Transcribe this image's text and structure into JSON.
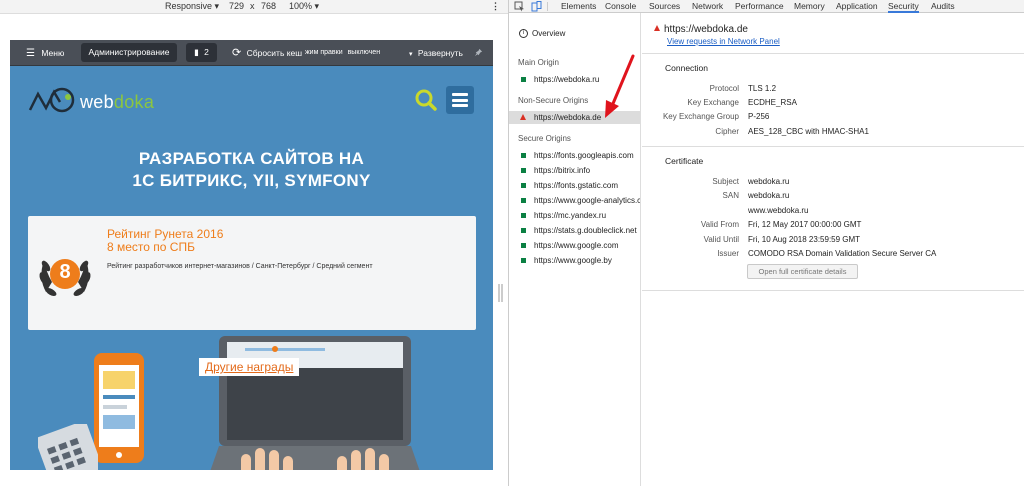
{
  "emulation": {
    "device": "Responsive",
    "width": "729",
    "times": "x",
    "height": "768",
    "zoom": "100%"
  },
  "panel": {
    "menu": "Меню",
    "admin": "Администрирование",
    "counter": "2",
    "reset_cache": "Сбросить кеш",
    "edit_mode": "жим правки",
    "edit_state": "выключен",
    "expand": "Развернуть"
  },
  "site": {
    "logo_web": "web",
    "logo_doka": "doka",
    "headline_1": "РАЗРАБОТКА САЙТОВ НА",
    "headline_2": "1С БИТРИКС, YII, SYMFONY",
    "award_title_1": "Рейтинг Рунета 2016",
    "award_title_2": "8 место по СПБ",
    "award_desc": "Рейтинг разработчиков интернет-магазинов / Санкт-Петербург / Средний сегмент",
    "medal_number": "8",
    "more_awards": "Другие награды"
  },
  "devtools": {
    "tabs": [
      "Elements",
      "Console",
      "Sources",
      "Network",
      "Performance",
      "Memory",
      "Application",
      "Security",
      "Audits"
    ],
    "active_tab": "Security",
    "sidebar": {
      "overview": "Overview",
      "main_origin_header": "Main Origin",
      "main_origin": "https://webdoka.ru",
      "non_secure_header": "Non-Secure Origins",
      "non_secure_origin": "https://webdoka.de",
      "secure_header": "Secure Origins",
      "secure_origins": [
        "https://fonts.googleapis.com",
        "https://bitrix.info",
        "https://fonts.gstatic.com",
        "https://www.google-analytics.com",
        "https://mc.yandex.ru",
        "https://stats.g.doubleclick.net",
        "https://www.google.com",
        "https://www.google.by"
      ]
    },
    "main": {
      "origin": "https://webdoka.de",
      "network_link": "View requests in Network Panel",
      "connection_title": "Connection",
      "connection": [
        {
          "label": "Protocol",
          "value": "TLS 1.2"
        },
        {
          "label": "Key Exchange",
          "value": "ECDHE_RSA"
        },
        {
          "label": "Key Exchange Group",
          "value": "P-256"
        },
        {
          "label": "Cipher",
          "value": "AES_128_CBC with HMAC-SHA1"
        }
      ],
      "certificate_title": "Certificate",
      "certificate": [
        {
          "label": "Subject",
          "value": "webdoka.ru"
        },
        {
          "label": "SAN",
          "value": "webdoka.ru"
        },
        {
          "label": "",
          "value": "www.webdoka.ru"
        },
        {
          "label": "Valid From",
          "value": "Fri, 12 May 2017 00:00:00 GMT"
        },
        {
          "label": "Valid Until",
          "value": "Fri, 10 Aug 2018 23:59:59 GMT"
        },
        {
          "label": "Issuer",
          "value": "COMODO RSA Domain Validation Secure Server CA"
        }
      ],
      "cert_button": "Open full certificate details"
    }
  },
  "colors": {
    "accent": "#3879d9",
    "site_blue": "#4a8bbd",
    "award_orange": "#ee7d1b",
    "secure_green": "#0b8043",
    "insecure_red": "#d93025"
  }
}
